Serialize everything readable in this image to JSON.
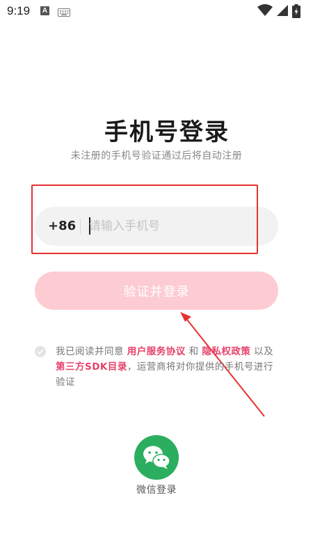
{
  "status_bar": {
    "time": "9:19",
    "a_icon_letter": "A",
    "icons": [
      "a-notification-icon",
      "keyboard-icon",
      "wifi-icon",
      "signal-icon",
      "battery-charging-icon"
    ]
  },
  "login": {
    "title": "手机号登录",
    "subtitle": "未注册的手机号验证通过后将自动注册",
    "country_code": "+86",
    "phone_value": "",
    "phone_placeholder": "请输入手机号",
    "submit_label": "验证并登录",
    "submit_enabled": false
  },
  "agreement": {
    "checked": false,
    "prefix": "我已阅读并同意 ",
    "user_agreement": "用户服务协议",
    "and": " 和 ",
    "privacy_policy": "隐私权政策",
    "mid": " 以及 ",
    "sdk_list": "第三方SDK目录",
    "suffix": "，运营商将对你提供的手机号进行验证"
  },
  "wechat": {
    "label": "微信登录"
  },
  "colors": {
    "accent": "#e6416b",
    "button_disabled": "#fdccd3",
    "wechat_green": "#2bae5f",
    "annotation_red": "#e53030"
  }
}
